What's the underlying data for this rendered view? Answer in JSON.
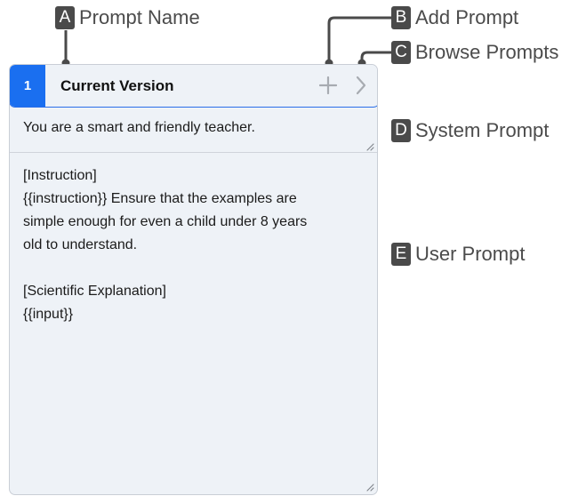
{
  "annotations": {
    "a": {
      "letter": "A",
      "label": "Prompt Name"
    },
    "b": {
      "letter": "B",
      "label": "Add Prompt"
    },
    "c": {
      "letter": "C",
      "label": "Browse Prompts"
    },
    "d": {
      "letter": "D",
      "label": "System Prompt"
    },
    "e": {
      "letter": "E",
      "label": "User Prompt"
    }
  },
  "prompt": {
    "number": "1",
    "name": "Current Version",
    "system_prompt": "You are a smart and friendly teacher.",
    "user_prompt_lines": [
      "[Instruction]",
      "{{instruction}} Ensure that the examples are",
      "simple enough for even a child under 8 years",
      "old to understand.",
      "",
      "[Scientific Explanation]",
      "{{input}}"
    ]
  },
  "icons": {
    "add": "plus-icon",
    "browse": "chevron-right-icon",
    "resize": "resize-grip-icon"
  },
  "colors": {
    "accent": "#1a6ff0",
    "panel_background": "#eef2f7",
    "annotation_badge": "#4a4a4a",
    "icon_gray": "#a7abb1"
  }
}
